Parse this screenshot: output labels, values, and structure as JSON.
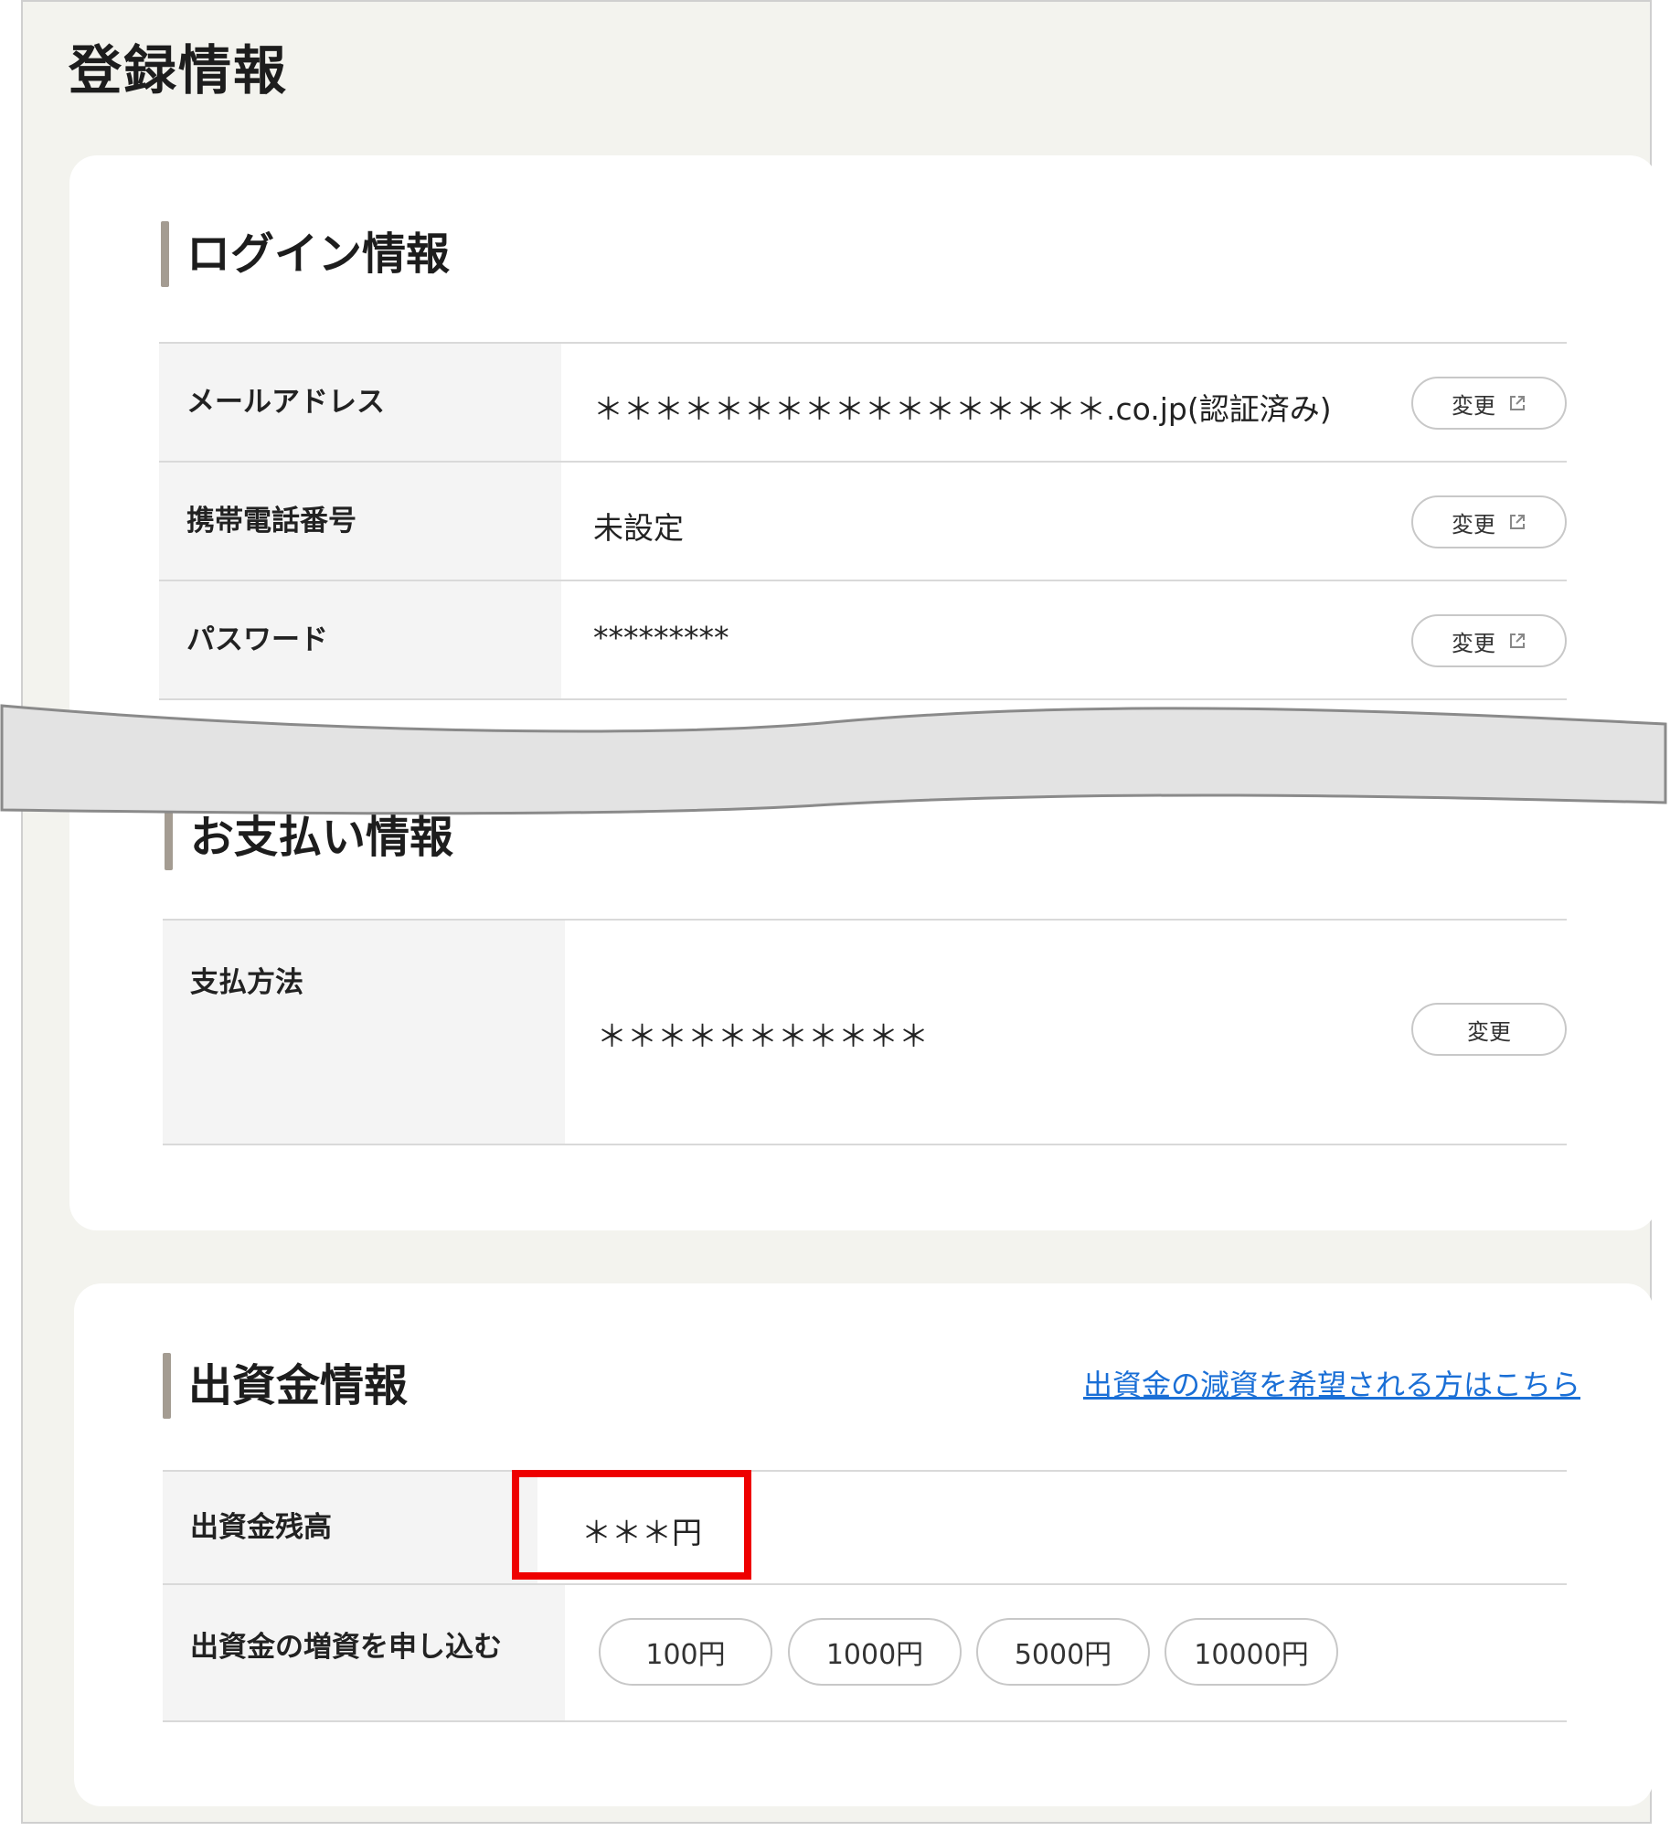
{
  "page": {
    "title": "登録情報"
  },
  "login": {
    "title": "ログイン情報",
    "rows": [
      {
        "label": "メールアドレス",
        "value": "＊＊＊＊＊＊＊＊＊＊＊＊＊＊＊＊＊.co.jp(認証済み)",
        "button": "変更"
      },
      {
        "label": "携帯電話番号",
        "value": "未設定",
        "button": "変更"
      },
      {
        "label": "パスワード",
        "value": "*********",
        "button": "変更"
      }
    ]
  },
  "payment": {
    "title": "お支払い情報",
    "rows": [
      {
        "label": "支払方法",
        "value": "＊＊＊＊＊＊＊＊＊＊＊",
        "button": "変更"
      }
    ]
  },
  "investment": {
    "title": "出資金情報",
    "reduce_link": "出資金の減資を希望される方はこちら",
    "balance_label": "出資金残高",
    "balance_value": "＊＊＊円",
    "increase_label": "出資金の増資を申し込む",
    "amounts": [
      "100円",
      "1000円",
      "5000円",
      "10000円"
    ]
  },
  "colors": {
    "accent_bar": "#a49c92",
    "link": "#1a6fd6",
    "highlight": "#ee0000"
  },
  "icons": {
    "external": "external-link-icon"
  }
}
